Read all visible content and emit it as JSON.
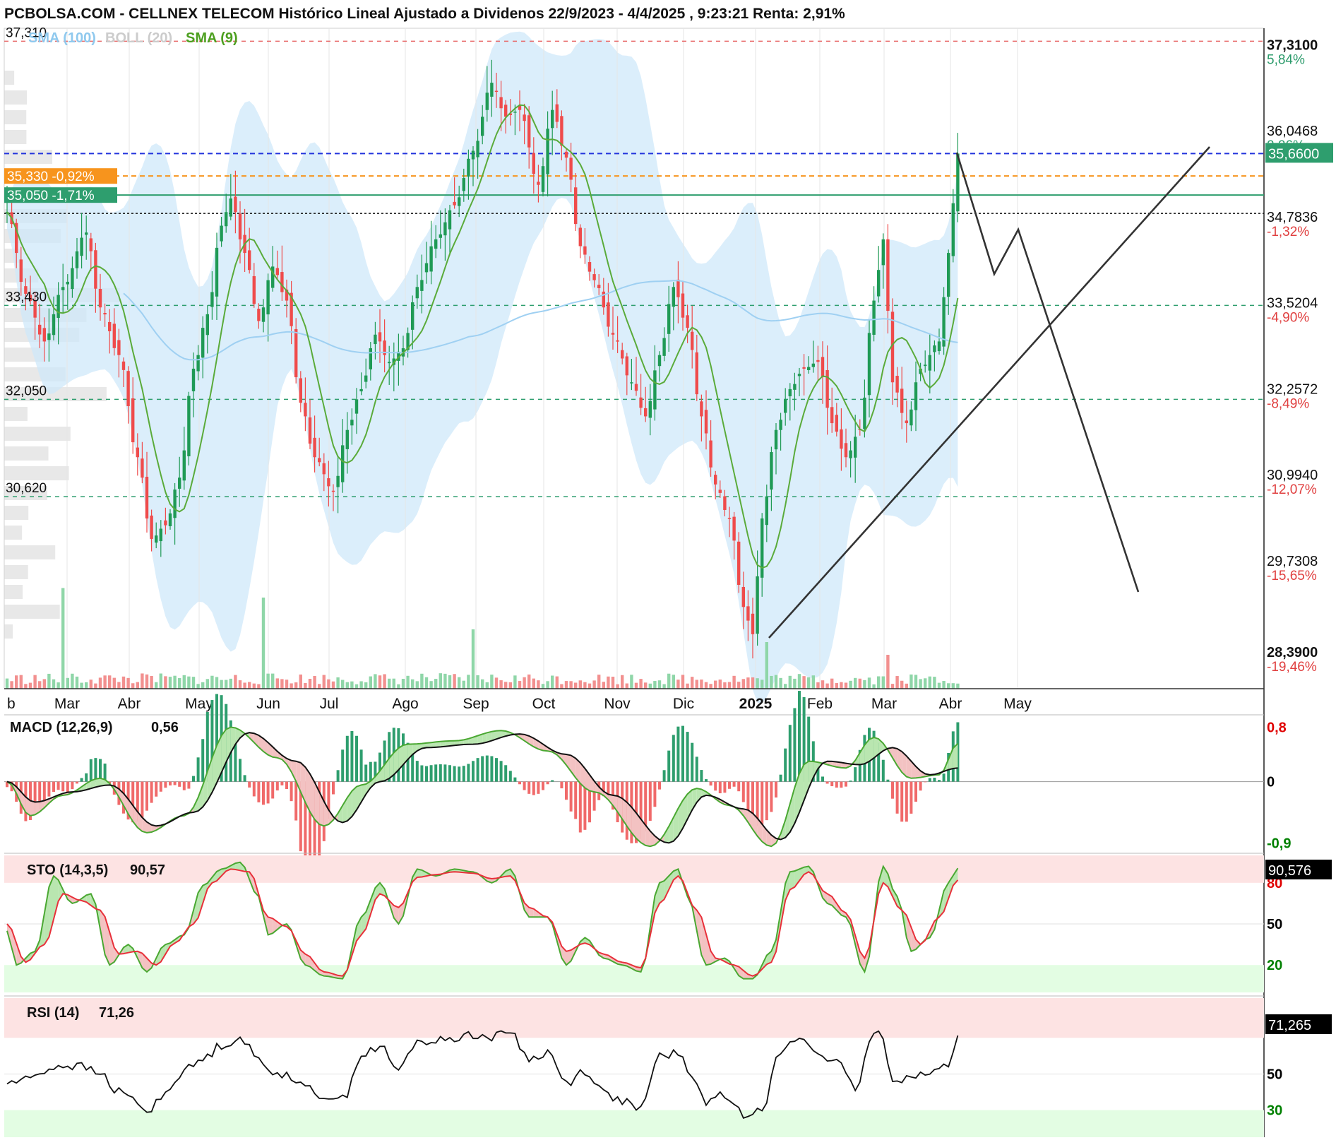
{
  "header": {
    "title": "PCBOLSA.COM - CELLNEX TELECOM Histórico Lineal Ajustado a Dividenos 22/9/2023 - 4/4/2025 , 9:23:21 Renta: 2,91%",
    "legend": [
      {
        "label": "SMA (100)",
        "color": "#8fc9ee"
      },
      {
        "label": "BOLL (20)",
        "color": "#cccccc"
      },
      {
        "label": "SMA (9)",
        "color": "#4c9f1f"
      }
    ]
  },
  "chart_data": [
    {
      "type": "candlestick",
      "title": "CELLNEX TELECOM",
      "x_months": [
        "b",
        "Mar",
        "Abr",
        "May",
        "Jun",
        "Jul",
        "Ago",
        "Sep",
        "Oct",
        "Nov",
        "Dic",
        "2025",
        "Feb",
        "Mar",
        "Abr",
        "May"
      ],
      "ylim": [
        27.8,
        37.5
      ],
      "right_axis": [
        {
          "price": "37,3100",
          "pct": "5,84%",
          "pct_color": "#2a9a6a",
          "v": 37.31
        },
        {
          "price": "36,0468",
          "pct": "2,26%",
          "pct_color": "#2a9a6a",
          "v": 36.0468
        },
        {
          "price": "34,7836",
          "pct": "-1,32%",
          "pct_color": "#e04040",
          "v": 34.7836
        },
        {
          "price": "33,5204",
          "pct": "-4,90%",
          "pct_color": "#e04040",
          "v": 33.5204
        },
        {
          "price": "32,2572",
          "pct": "-8,49%",
          "pct_color": "#e04040",
          "v": 32.2572
        },
        {
          "price": "30,9940",
          "pct": "-12,07%",
          "pct_color": "#e04040",
          "v": 30.994
        },
        {
          "price": "29,7308",
          "pct": "-15,65%",
          "pct_color": "#e04040",
          "v": 29.7308
        },
        {
          "price": "28,3900",
          "pct": "-19,46%",
          "pct_color": "#e04040",
          "v": 28.39
        }
      ],
      "current_price": "35,6600",
      "level_labels": [
        {
          "text": "37,310",
          "v": 37.31
        },
        {
          "text": "33,430",
          "v": 33.43
        },
        {
          "text": "32,050",
          "v": 32.05
        },
        {
          "text": "30,620",
          "v": 30.62
        }
      ],
      "badges": [
        {
          "text": "35,330 -0,92%",
          "v": 35.33,
          "color": "#f7941d"
        },
        {
          "text": "35,050 -1,71%",
          "v": 35.05,
          "color": "#2e9e6e"
        }
      ],
      "close_anchors": [
        [
          0,
          34.8
        ],
        [
          4,
          33.6
        ],
        [
          8,
          32.9
        ],
        [
          12,
          33.7
        ],
        [
          17,
          34.5
        ],
        [
          20,
          33.4
        ],
        [
          24,
          32.7
        ],
        [
          28,
          31.2
        ],
        [
          31,
          30.0
        ],
        [
          34,
          30.2
        ],
        [
          37,
          30.9
        ],
        [
          40,
          32.5
        ],
        [
          43,
          33.3
        ],
        [
          46,
          34.6
        ],
        [
          48,
          35.0
        ],
        [
          51,
          34.2
        ],
        [
          54,
          33.2
        ],
        [
          57,
          34.0
        ],
        [
          60,
          33.5
        ],
        [
          63,
          32.0
        ],
        [
          66,
          31.2
        ],
        [
          70,
          30.7
        ],
        [
          73,
          31.6
        ],
        [
          76,
          32.2
        ],
        [
          79,
          33.0
        ],
        [
          82,
          32.6
        ],
        [
          85,
          32.8
        ],
        [
          88,
          33.7
        ],
        [
          92,
          34.4
        ],
        [
          96,
          34.9
        ],
        [
          100,
          35.7
        ],
        [
          104,
          36.7
        ],
        [
          107,
          36.2
        ],
        [
          110,
          36.3
        ],
        [
          114,
          35.2
        ],
        [
          117,
          36.3
        ],
        [
          120,
          35.6
        ],
        [
          123,
          34.3
        ],
        [
          126,
          33.8
        ],
        [
          130,
          33.0
        ],
        [
          134,
          32.3
        ],
        [
          137,
          31.8
        ],
        [
          140,
          32.7
        ],
        [
          143,
          33.7
        ],
        [
          146,
          33.1
        ],
        [
          149,
          31.8
        ],
        [
          152,
          30.8
        ],
        [
          155,
          30.3
        ],
        [
          158,
          29.0
        ],
        [
          160,
          28.6
        ],
        [
          162,
          30.3
        ],
        [
          165,
          31.6
        ],
        [
          168,
          32.2
        ],
        [
          171,
          32.5
        ],
        [
          174,
          32.6
        ],
        [
          177,
          31.7
        ],
        [
          180,
          31.2
        ],
        [
          183,
          31.6
        ],
        [
          186,
          33.5
        ],
        [
          188,
          34.4
        ],
        [
          190,
          32.3
        ],
        [
          193,
          31.7
        ],
        [
          196,
          32.5
        ],
        [
          200,
          32.9
        ],
        [
          202,
          34.2
        ],
        [
          204,
          35.66
        ]
      ],
      "volume_spikes": [
        [
          12,
          0.95
        ],
        [
          55,
          0.86
        ],
        [
          100,
          0.56
        ],
        [
          163,
          0.44
        ],
        [
          189,
          0.32
        ]
      ],
      "sma9_label": "SMA (9)"
    },
    {
      "type": "macd",
      "label": "MACD (12,26,9)",
      "value": "0,56",
      "ylim": [
        -1.0,
        0.95
      ],
      "ticks": [
        {
          "text": "0,8",
          "v": 0.8,
          "color": "#e00000"
        },
        {
          "text": "0",
          "v": 0,
          "color": "#000000"
        },
        {
          "text": "-0,9",
          "v": -0.9,
          "color": "#008000"
        }
      ],
      "macd_anchors": [
        [
          0,
          0
        ],
        [
          5,
          -0.5
        ],
        [
          12,
          -0.2
        ],
        [
          20,
          0.05
        ],
        [
          30,
          -0.75
        ],
        [
          38,
          -0.5
        ],
        [
          48,
          0.8
        ],
        [
          58,
          0.35
        ],
        [
          68,
          -0.65
        ],
        [
          76,
          -0.05
        ],
        [
          86,
          0.55
        ],
        [
          96,
          0.6
        ],
        [
          106,
          0.75
        ],
        [
          116,
          0.45
        ],
        [
          126,
          -0.15
        ],
        [
          138,
          -0.95
        ],
        [
          148,
          -0.1
        ],
        [
          155,
          -0.35
        ],
        [
          164,
          -0.95
        ],
        [
          172,
          0.3
        ],
        [
          180,
          0.2
        ],
        [
          186,
          0.65
        ],
        [
          194,
          0.05
        ],
        [
          200,
          0.1
        ],
        [
          204,
          0.56
        ]
      ],
      "signal_anchors": [
        [
          0,
          0
        ],
        [
          6,
          -0.3
        ],
        [
          14,
          -0.15
        ],
        [
          22,
          -0.05
        ],
        [
          32,
          -0.65
        ],
        [
          40,
          -0.45
        ],
        [
          52,
          0.72
        ],
        [
          62,
          0.3
        ],
        [
          72,
          -0.6
        ],
        [
          80,
          0.0
        ],
        [
          90,
          0.5
        ],
        [
          100,
          0.55
        ],
        [
          110,
          0.7
        ],
        [
          120,
          0.4
        ],
        [
          130,
          -0.2
        ],
        [
          142,
          -0.9
        ],
        [
          150,
          -0.2
        ],
        [
          158,
          -0.4
        ],
        [
          166,
          -0.85
        ],
        [
          176,
          0.3
        ],
        [
          183,
          0.25
        ],
        [
          190,
          0.5
        ],
        [
          198,
          0.1
        ],
        [
          204,
          0.2
        ]
      ]
    },
    {
      "type": "stochastic",
      "label": "STO (14,3,5)",
      "value": "90,57",
      "current": "90,576",
      "ylim": [
        0,
        100
      ],
      "ticks": [
        {
          "text": "80",
          "v": 80,
          "color": "#e00000"
        },
        {
          "text": "50",
          "v": 50,
          "color": "#000000"
        },
        {
          "text": "20",
          "v": 20,
          "color": "#008000"
        }
      ],
      "k_anchors": [
        [
          0,
          45
        ],
        [
          2,
          20
        ],
        [
          6,
          30
        ],
        [
          10,
          85
        ],
        [
          14,
          65
        ],
        [
          18,
          72
        ],
        [
          22,
          20
        ],
        [
          26,
          35
        ],
        [
          30,
          15
        ],
        [
          34,
          35
        ],
        [
          38,
          42
        ],
        [
          42,
          78
        ],
        [
          46,
          90
        ],
        [
          50,
          95
        ],
        [
          54,
          70
        ],
        [
          56,
          42
        ],
        [
          60,
          50
        ],
        [
          64,
          20
        ],
        [
          68,
          12
        ],
        [
          72,
          10
        ],
        [
          76,
          55
        ],
        [
          80,
          80
        ],
        [
          84,
          50
        ],
        [
          88,
          90
        ],
        [
          92,
          85
        ],
        [
          96,
          90
        ],
        [
          100,
          88
        ],
        [
          104,
          80
        ],
        [
          108,
          90
        ],
        [
          112,
          55
        ],
        [
          116,
          55
        ],
        [
          120,
          20
        ],
        [
          124,
          40
        ],
        [
          128,
          25
        ],
        [
          132,
          20
        ],
        [
          136,
          15
        ],
        [
          140,
          80
        ],
        [
          144,
          90
        ],
        [
          146,
          70
        ],
        [
          150,
          20
        ],
        [
          154,
          25
        ],
        [
          158,
          10
        ],
        [
          160,
          10
        ],
        [
          164,
          30
        ],
        [
          168,
          88
        ],
        [
          172,
          92
        ],
        [
          176,
          65
        ],
        [
          180,
          55
        ],
        [
          184,
          15
        ],
        [
          188,
          92
        ],
        [
          191,
          70
        ],
        [
          194,
          30
        ],
        [
          198,
          40
        ],
        [
          202,
          80
        ],
        [
          204,
          90.6
        ]
      ],
      "d_anchors": [
        [
          0,
          50
        ],
        [
          4,
          22
        ],
        [
          8,
          35
        ],
        [
          12,
          72
        ],
        [
          16,
          67
        ],
        [
          20,
          60
        ],
        [
          24,
          28
        ],
        [
          28,
          30
        ],
        [
          32,
          20
        ],
        [
          36,
          36
        ],
        [
          40,
          50
        ],
        [
          44,
          80
        ],
        [
          48,
          90
        ],
        [
          52,
          88
        ],
        [
          56,
          55
        ],
        [
          60,
          48
        ],
        [
          64,
          28
        ],
        [
          68,
          15
        ],
        [
          72,
          12
        ],
        [
          76,
          42
        ],
        [
          80,
          72
        ],
        [
          84,
          62
        ],
        [
          88,
          84
        ],
        [
          92,
          86
        ],
        [
          96,
          88
        ],
        [
          100,
          87
        ],
        [
          104,
          83
        ],
        [
          108,
          85
        ],
        [
          112,
          62
        ],
        [
          116,
          55
        ],
        [
          120,
          30
        ],
        [
          124,
          36
        ],
        [
          128,
          28
        ],
        [
          132,
          22
        ],
        [
          136,
          18
        ],
        [
          140,
          65
        ],
        [
          144,
          85
        ],
        [
          148,
          60
        ],
        [
          152,
          25
        ],
        [
          156,
          20
        ],
        [
          160,
          12
        ],
        [
          164,
          22
        ],
        [
          168,
          75
        ],
        [
          172,
          88
        ],
        [
          176,
          72
        ],
        [
          180,
          58
        ],
        [
          184,
          25
        ],
        [
          188,
          80
        ],
        [
          192,
          60
        ],
        [
          196,
          35
        ],
        [
          200,
          55
        ],
        [
          204,
          82
        ]
      ]
    },
    {
      "type": "rsi",
      "label": "RSI (14)",
      "value": "71,26",
      "current": "71,265",
      "ylim": [
        15,
        92
      ],
      "ticks": [
        {
          "text": "50",
          "v": 50,
          "color": "#000000"
        },
        {
          "text": "30",
          "v": 30,
          "color": "#008000"
        }
      ],
      "rsi_anchors": [
        [
          0,
          45
        ],
        [
          4,
          47
        ],
        [
          8,
          52
        ],
        [
          12,
          55
        ],
        [
          16,
          54
        ],
        [
          20,
          50
        ],
        [
          24,
          40
        ],
        [
          28,
          35
        ],
        [
          30,
          28
        ],
        [
          34,
          40
        ],
        [
          38,
          52
        ],
        [
          42,
          58
        ],
        [
          46,
          66
        ],
        [
          50,
          70
        ],
        [
          54,
          58
        ],
        [
          56,
          52
        ],
        [
          60,
          50
        ],
        [
          64,
          42
        ],
        [
          68,
          38
        ],
        [
          72,
          36
        ],
        [
          76,
          60
        ],
        [
          80,
          65
        ],
        [
          84,
          52
        ],
        [
          88,
          68
        ],
        [
          92,
          68
        ],
        [
          96,
          70
        ],
        [
          100,
          72
        ],
        [
          104,
          70
        ],
        [
          108,
          74
        ],
        [
          112,
          58
        ],
        [
          116,
          62
        ],
        [
          120,
          45
        ],
        [
          124,
          52
        ],
        [
          128,
          40
        ],
        [
          132,
          35
        ],
        [
          136,
          30
        ],
        [
          140,
          60
        ],
        [
          144,
          62
        ],
        [
          146,
          52
        ],
        [
          150,
          35
        ],
        [
          154,
          38
        ],
        [
          158,
          28
        ],
        [
          162,
          32
        ],
        [
          166,
          62
        ],
        [
          170,
          70
        ],
        [
          174,
          62
        ],
        [
          178,
          56
        ],
        [
          182,
          42
        ],
        [
          186,
          72
        ],
        [
          188,
          71
        ],
        [
          190,
          45
        ],
        [
          194,
          50
        ],
        [
          198,
          50
        ],
        [
          202,
          55
        ],
        [
          204,
          71.3
        ]
      ]
    }
  ]
}
